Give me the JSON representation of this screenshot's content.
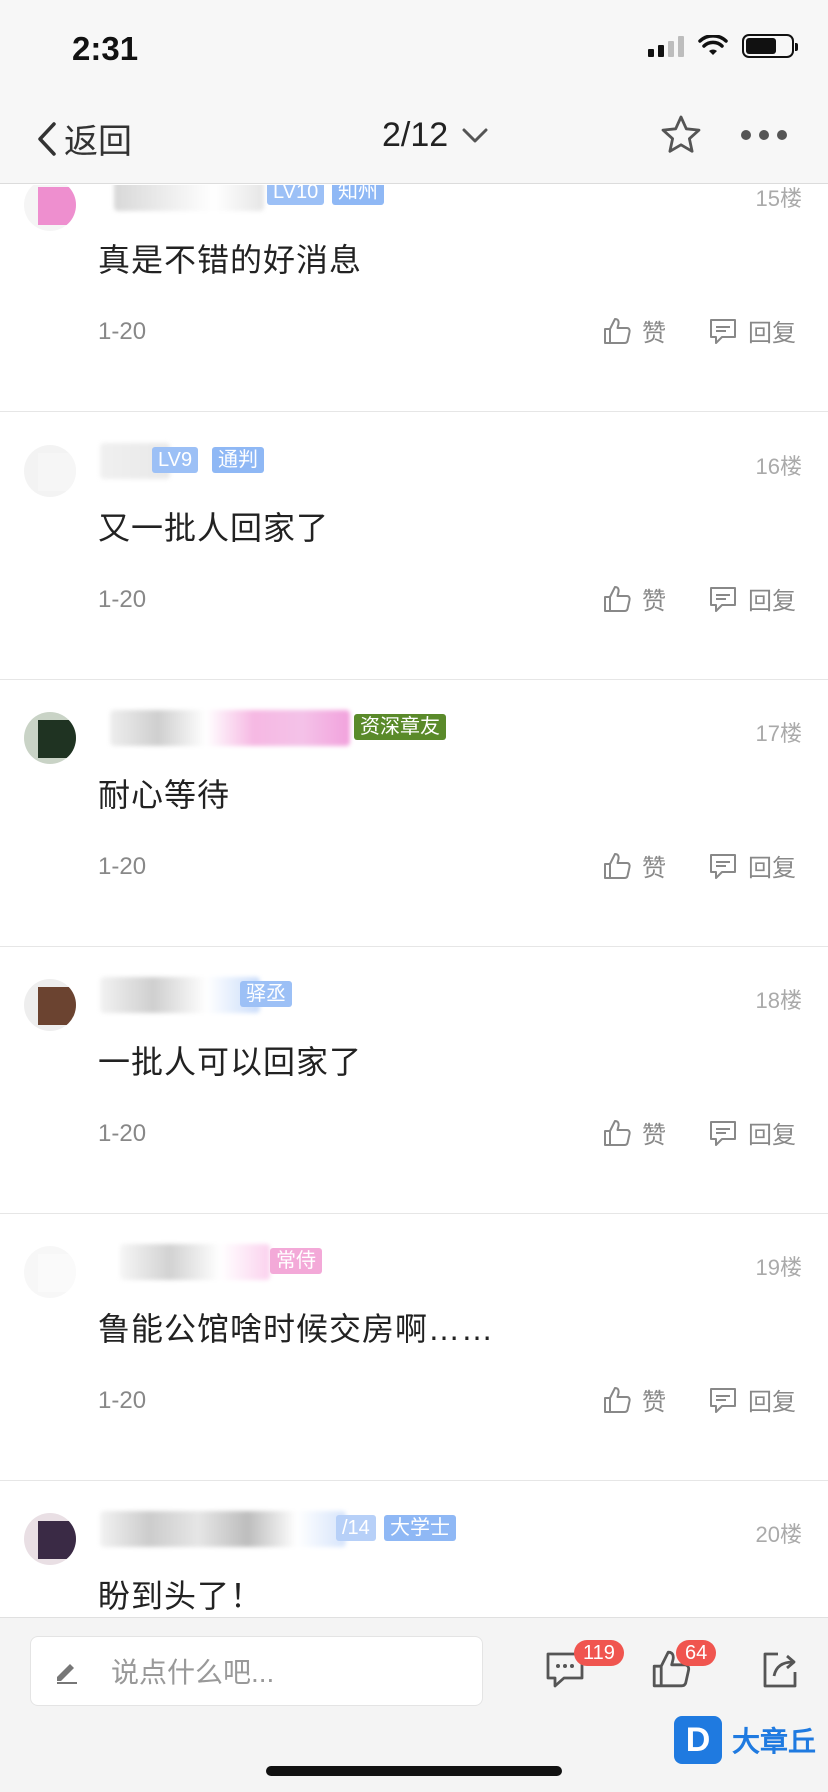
{
  "status_bar": {
    "time": "2:31"
  },
  "nav": {
    "back_label": "返回",
    "page_indicator": "2/12"
  },
  "colors": {
    "accent": "#1f7ae0",
    "badge_blue": "#8fb8f5",
    "badge_green": "#5a8a2a",
    "badge_pink": "#f3a9d8",
    "count_badge": "#f0554f"
  },
  "posts": [
    {
      "floor": "15楼",
      "level": "LV10",
      "title": "知州",
      "content": "真是不错的好消息",
      "date": "1-20",
      "like_label": "赞",
      "reply_label": "回复"
    },
    {
      "floor": "16楼",
      "level": "LV9",
      "title": "通判",
      "content": "又一批人回家了",
      "date": "1-20",
      "like_label": "赞",
      "reply_label": "回复"
    },
    {
      "floor": "17楼",
      "title": "资深章友",
      "content": "耐心等待",
      "date": "1-20",
      "like_label": "赞",
      "reply_label": "回复"
    },
    {
      "floor": "18楼",
      "title": "驿丞",
      "content": "一批人可以回家了",
      "date": "1-20",
      "like_label": "赞",
      "reply_label": "回复"
    },
    {
      "floor": "19楼",
      "title": "常侍",
      "content": "鲁能公馆啥时候交房啊……",
      "date": "1-20",
      "like_label": "赞",
      "reply_label": "回复"
    },
    {
      "floor": "20楼",
      "level": "/14",
      "title": "大学士",
      "content": "盼到头了！"
    }
  ],
  "bottom_bar": {
    "input_placeholder": "说点什么吧...",
    "comment_count": "119",
    "like_count": "64"
  },
  "watermark": {
    "logo_letter": "D",
    "text": "大章丘"
  },
  "icons": [
    "chevron-left-icon",
    "chevron-down-icon",
    "star-icon",
    "more-icon",
    "thumb-up-icon",
    "reply-icon",
    "pencil-icon",
    "comment-icon",
    "share-icon"
  ]
}
